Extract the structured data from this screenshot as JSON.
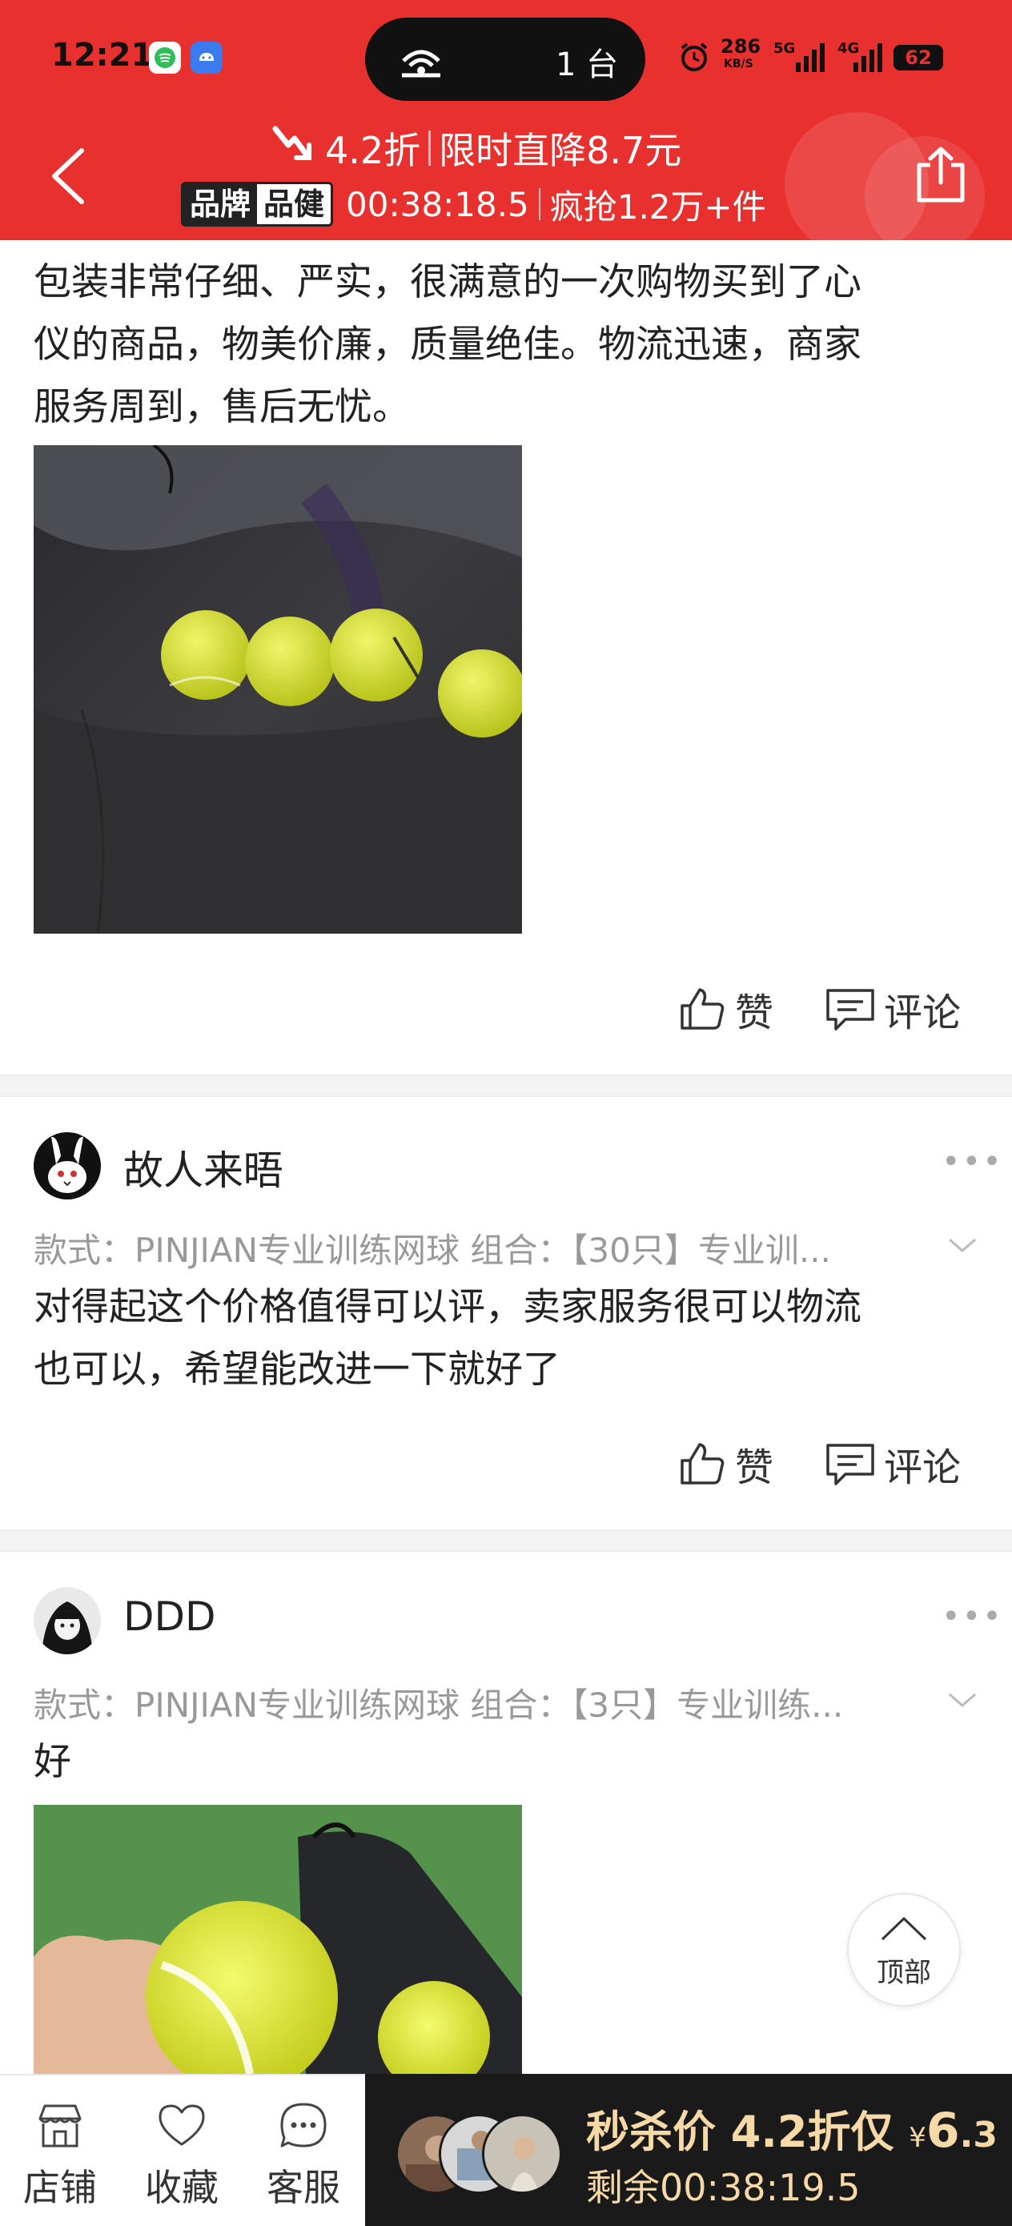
{
  "status_bar": {
    "time": "12:21",
    "island_text": "1 台",
    "net_speed": "286",
    "net_unit": "KB/S",
    "signal1": "5G",
    "signal2": "4G",
    "battery": "62"
  },
  "header": {
    "discount": "4.2折",
    "drop_text": "限时直降8.7元",
    "brand_tag_1": "品牌",
    "brand_tag_2": "品健",
    "countdown": "00:38:18.5",
    "sold_text": "疯抢1.2万+件"
  },
  "reviews": [
    {
      "text_lines": [
        "包装非常仔细、严实，很满意的一次购物买到了心",
        "仪的商品，物美价廉，质量绝佳。物流迅速，商家",
        "服务周到，售后无忧。"
      ],
      "like_label": "赞",
      "comment_label": "评论"
    },
    {
      "username": "故人来晤",
      "spec": "款式：PINJIAN专业训练网球  组合：【30只】专业训...",
      "text_lines": [
        "对得起这个价格值得可以评，卖家服务很可以物流",
        "也可以，希望能改进一下就好了"
      ],
      "like_label": "赞",
      "comment_label": "评论"
    },
    {
      "username": "DDD",
      "spec": "款式：PINJIAN专业训练网球  组合：【3只】专业训练...",
      "text_lines": [
        "好"
      ]
    }
  ],
  "back_to_top": "顶部",
  "bottom_bar": {
    "shop": "店铺",
    "favorite": "收藏",
    "service": "客服",
    "flash_label": "秒杀价 4.2折仅",
    "currency": "¥",
    "price_int": "6",
    "price_dec": ".3",
    "remaining": "剩余00:38:19.5"
  },
  "icons": [
    "back-arrow-icon",
    "share-icon",
    "trend-down-icon",
    "thumb-up-icon",
    "comment-icon",
    "more-dots-icon",
    "chevron-down-icon",
    "arrow-up-icon",
    "shop-icon",
    "heart-icon",
    "chat-icon"
  ],
  "colors": {
    "brand_red": "#e8302f",
    "flash_gold": "#f6d9a6",
    "dark_bar": "#1a1a1a"
  }
}
